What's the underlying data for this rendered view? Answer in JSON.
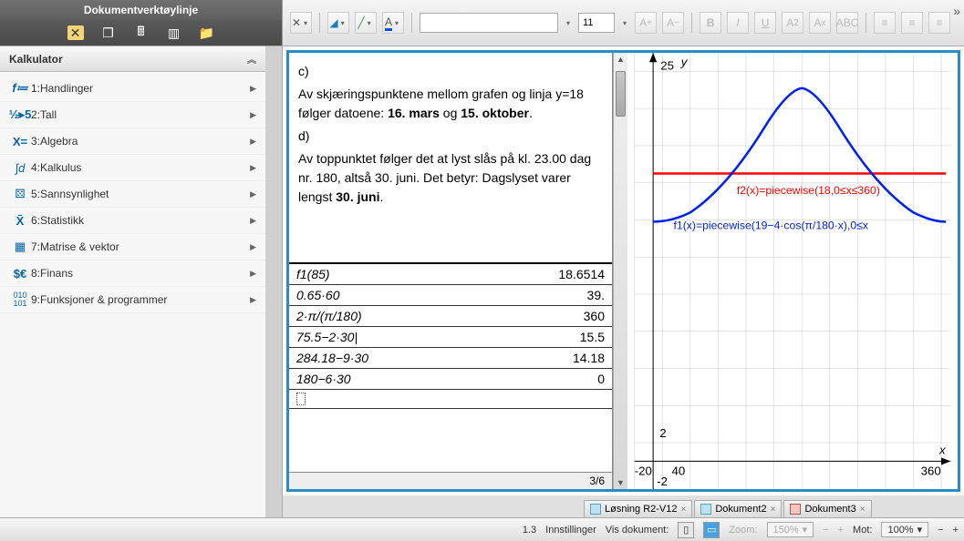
{
  "doc_toolbar_title": "Dokumentverktøylinje",
  "format_toolbar": {
    "font_size": "11"
  },
  "sidebar": {
    "panel_title": "Kalkulator",
    "items": [
      {
        "label": "1:Handlinger"
      },
      {
        "label": "2:Tall"
      },
      {
        "label": "3:Algebra"
      },
      {
        "label": "4:Kalkulus"
      },
      {
        "label": "5:Sannsynlighet"
      },
      {
        "label": "6:Statistikk"
      },
      {
        "label": "7:Matrise & vektor"
      },
      {
        "label": "8:Finans"
      },
      {
        "label": "9:Funksjoner & programmer"
      }
    ]
  },
  "notes": {
    "part_c": "c)",
    "c_line1": "Av skjæringspunktene mellom grafen og linja y=18 følger datoene: ",
    "c_bold1": "16. mars",
    "c_mid": " og ",
    "c_bold2": "15. oktober",
    "c_end": ".",
    "part_d": "d)",
    "d_line1": "Av toppunktet følger det at lyst slås på kl. 23.00 dag nr. 180, altså 30. juni. Det betyr: Dagslyset varer lengst ",
    "d_bold": "30. juni",
    "d_end": "."
  },
  "calc": {
    "rows": [
      {
        "expr": "f1(85)",
        "res": "18.6514"
      },
      {
        "expr": "0.65·60",
        "res": "39."
      },
      {
        "expr": "2·π/(π/180)",
        "res": "360"
      },
      {
        "expr": "75.5−2·30|",
        "res": "15.5"
      },
      {
        "expr": "284.18−9·30",
        "res": "14.18"
      },
      {
        "expr": "180−6·30",
        "res": "0"
      }
    ],
    "status": "3/6"
  },
  "graph": {
    "y_tick_top": "25",
    "y_tick_bottom": "2",
    "y_label": "y",
    "x_label": "x",
    "x_tick_left": "-20",
    "x_tick_40": "40",
    "x_tick_right": "360",
    "y_tick_neg": "-2",
    "f2_label": "f2(x)=piecewise(18,0≤x≤360)",
    "f1_label": "f1(x)=piecewise(19−4·cos(π/180·x),0≤x"
  },
  "tabs": [
    {
      "label": "Løsning R2-V12",
      "color": "#4aa3df"
    },
    {
      "label": "Dokument2",
      "color": "#4aa3df"
    },
    {
      "label": "Dokument3",
      "color": "#d66"
    }
  ],
  "status_bar": {
    "page": "1.3",
    "settings": "Innstillinger",
    "view_doc": "Vis dokument:",
    "zoom_label": "Zoom:",
    "zoom_value": "150%",
    "mot_label": "Mot:",
    "mot_value": "100%"
  },
  "chart_data": {
    "type": "line",
    "title": "",
    "xlabel": "x",
    "ylabel": "y",
    "xlim": [
      -20,
      370
    ],
    "ylim": [
      -2,
      26
    ],
    "series": [
      {
        "name": "f2(x)=piecewise(18,0≤x≤360)",
        "kind": "constant",
        "y": 18,
        "x_range": [
          0,
          360
        ],
        "color": "#ff0000"
      },
      {
        "name": "f1(x)=piecewise(19−4·cos(π/180·x),0≤x≤360)",
        "kind": "expression",
        "expression": "19 - 4*cos(pi/180 * x)",
        "x_range": [
          0,
          360
        ],
        "color": "#0022ee",
        "sampled": {
          "x": [
            0,
            30,
            60,
            90,
            120,
            150,
            180,
            210,
            240,
            270,
            300,
            330,
            360
          ],
          "y": [
            15.0,
            15.54,
            17.0,
            19.0,
            21.0,
            22.46,
            23.0,
            22.46,
            21.0,
            19.0,
            17.0,
            15.54,
            15.0
          ]
        }
      }
    ]
  }
}
